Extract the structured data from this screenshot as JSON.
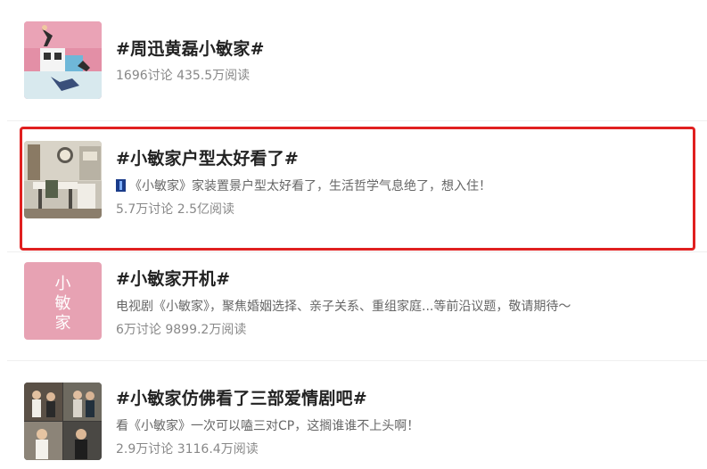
{
  "topics": [
    {
      "title": "#周迅黄磊小敏家#",
      "description": "",
      "stats": "1696讨论 435.5万阅读"
    },
    {
      "title": "#小敏家户型太好看了#",
      "description": "《小敏家》家装置景户型太好看了，生活哲学气息绝了，想入住！",
      "stats": "5.7万讨论 2.5亿阅读"
    },
    {
      "title": "#小敏家开机#",
      "description": "电视剧《小敏家》，聚焦婚姻选择、亲子关系、重组家庭...等前沿议题，敬请期待～",
      "stats": "6万讨论 9899.2万阅读"
    },
    {
      "title": "#小敏家仿佛看了三部爱情剧吧#",
      "description": "看《小敏家》一次可以嗑三对CP，这搁谁谁不上头啊！",
      "stats": "2.9万讨论 3116.4万阅读"
    }
  ],
  "thumbnails": {
    "poster_3_text": "小敏家"
  },
  "colors": {
    "highlight_border": "#e02020",
    "title_text": "#222222",
    "description_text": "#666666",
    "stats_text": "#888888"
  }
}
